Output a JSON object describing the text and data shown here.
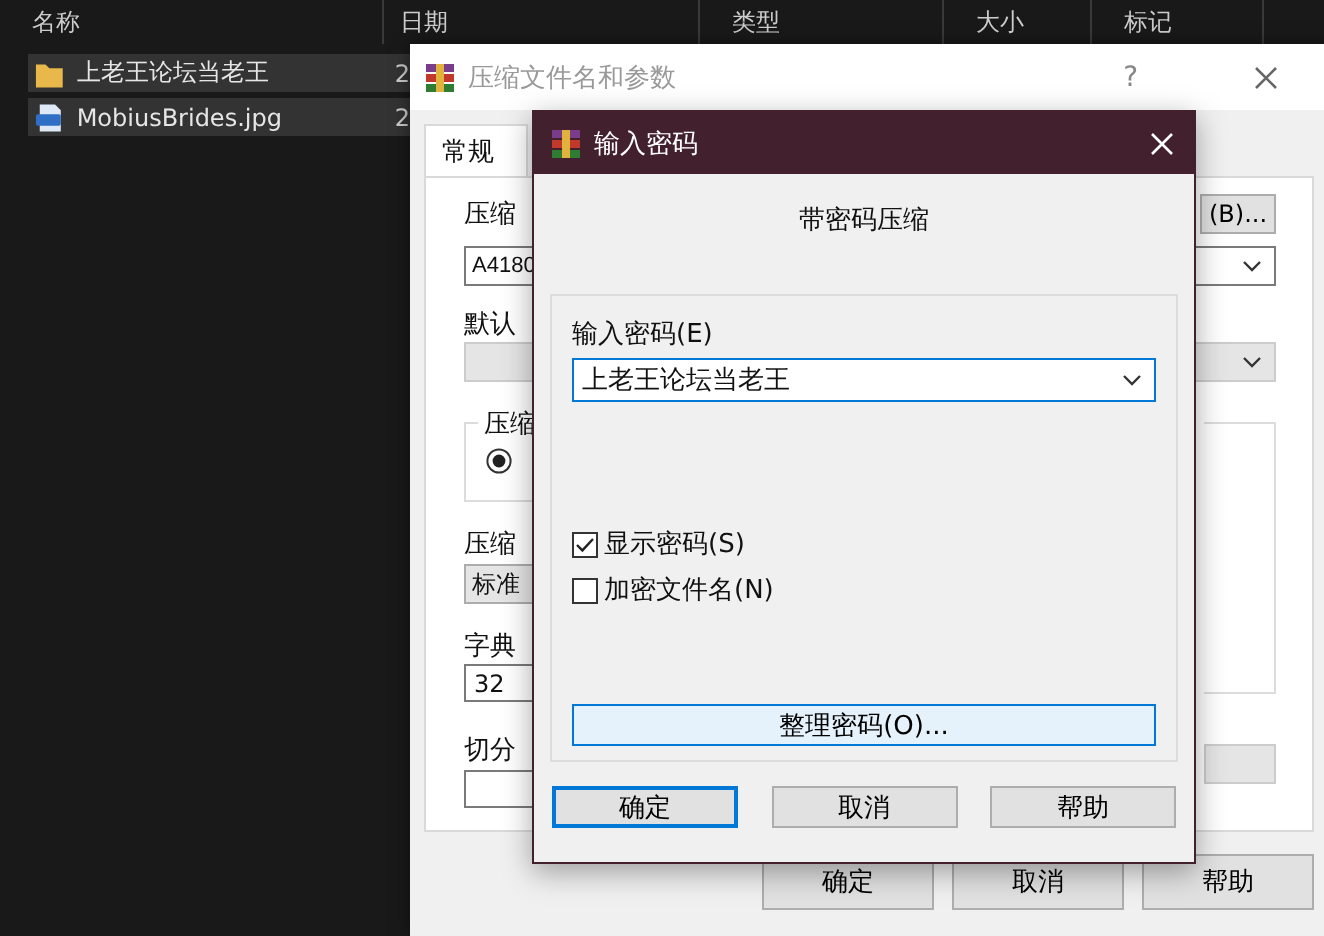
{
  "explorer": {
    "columns": [
      "名称",
      "日期",
      "类型",
      "大小",
      "标记"
    ],
    "files": [
      {
        "name": "上老王论坛当老王",
        "date": "2",
        "kind": "folder"
      },
      {
        "name": "MobiusBrides.jpg",
        "date": "2",
        "kind": "image"
      }
    ]
  },
  "archive_dialog": {
    "title": "压缩文件名和参数",
    "help": "?",
    "tab": {
      "label": "常规",
      "selected": true
    },
    "archive_name_label": "压缩",
    "browse_button": "(B)...",
    "archive_name": "A4180",
    "profile_label": "默认",
    "format_group_label": "压缩",
    "format_radio": {
      "selected": true
    },
    "method_label": "压缩",
    "method": "标准",
    "dictionary_label": "字典",
    "dictionary": "32",
    "split_label": "切分",
    "buttons": [
      "确定",
      "取消",
      "帮助"
    ]
  },
  "password_dialog": {
    "title": "输入密码",
    "heading": "带密码压缩",
    "password_label": "输入密码(E)",
    "password": "上老王论坛当老王",
    "checkboxes": [
      {
        "label": "显示密码(S)",
        "checked": true
      },
      {
        "label": "加密文件名(N)",
        "checked": false
      }
    ],
    "manage_button": "整理密码(O)...",
    "buttons": [
      {
        "label": "确定",
        "default": true
      },
      {
        "label": "取消",
        "default": false
      },
      {
        "label": "帮助",
        "default": false
      }
    ]
  }
}
